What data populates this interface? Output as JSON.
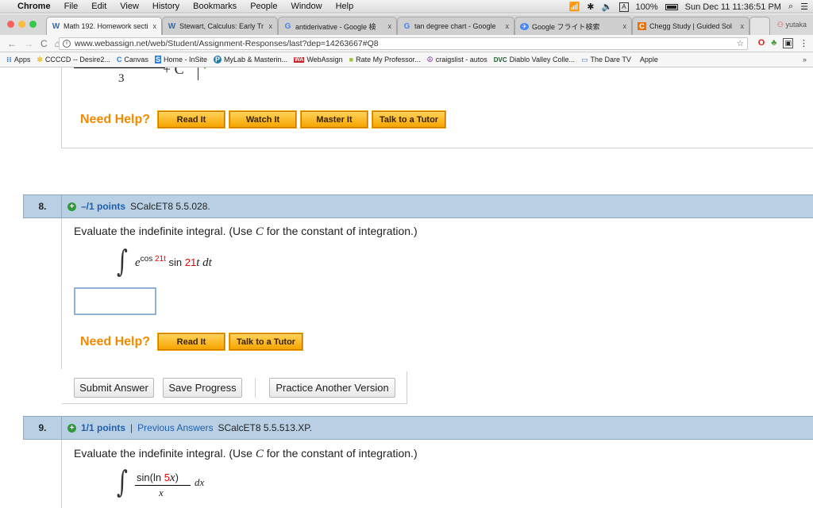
{
  "menubar": {
    "app": "Chrome",
    "items": [
      "File",
      "Edit",
      "View",
      "History",
      "Bookmarks",
      "People",
      "Window",
      "Help"
    ],
    "status": {
      "input_badge": "A",
      "battery": "100%",
      "datetime": "Sun Dec 11  11:36:51 PM"
    }
  },
  "tabs": [
    {
      "icon": "W",
      "label": "Math 192. Homework secti",
      "active": true
    },
    {
      "icon": "W",
      "label": "Stewart, Calculus: Early Tr"
    },
    {
      "icon": "G",
      "label": "antiderivative - Google 検"
    },
    {
      "icon": "G",
      "label": "tan degree chart - Google"
    },
    {
      "icon": "G",
      "label": "Google フライト検索"
    },
    {
      "icon": "C",
      "label": "Chegg Study | Guided Sol"
    }
  ],
  "tab_close": "x",
  "profile": "yutaka",
  "address": {
    "url": "www.webassign.net/web/Student/Assignment-Responses/last?dep=14263667#Q8"
  },
  "bookmarks": [
    {
      "icon": "⁝⁝",
      "label": "Apps"
    },
    {
      "icon": "✻",
      "label": "CCCCD -- Desire2..."
    },
    {
      "icon": "C",
      "label": "Canvas"
    },
    {
      "icon": "S",
      "label": "Home - InSite"
    },
    {
      "icon": "P",
      "label": "MyLab & Masterin..."
    },
    {
      "icon": "WA",
      "label": "WebAssign"
    },
    {
      "icon": "■",
      "label": "Rate My Professor..."
    },
    {
      "icon": "☮",
      "label": "craigslist - autos"
    },
    {
      "icon": "DVC",
      "label": "Diablo Valley Colle..."
    },
    {
      "icon": "▭",
      "label": "The Dare TV"
    },
    {
      "icon": "",
      "label": "Apple"
    }
  ],
  "bookmarks_more": "»",
  "prev_question": {
    "denominator": "3",
    "plus_c": "+ C",
    "help_label": "Need Help?",
    "help_buttons": [
      "Read It",
      "Watch It",
      "Master It",
      "Talk to a Tutor"
    ]
  },
  "q8": {
    "number": "8.",
    "points": "–/1 points",
    "code": "SCalcET8 5.5.028.",
    "prompt_a": "Evaluate the indefinite integral. (Use ",
    "prompt_c": "C",
    "prompt_b": " for the constant of integration.)",
    "expr_e": "e",
    "expr_cos": "cos ",
    "expr_21t_sup": "21t",
    "expr_sin": " sin ",
    "expr_21": "21",
    "expr_t": "t",
    "expr_dt": " dt",
    "help_label": "Need Help?",
    "help_buttons": [
      "Read It",
      "Talk to a Tutor"
    ],
    "actions": [
      "Submit Answer",
      "Save Progress",
      "Practice Another Version"
    ]
  },
  "q9": {
    "number": "9.",
    "points": "1/1 points",
    "sep": "|",
    "prev_answers": "Previous Answers",
    "code": "SCalcET8 5.5.513.XP.",
    "prompt_a": "Evaluate the indefinite integral. (Use ",
    "prompt_c": "C",
    "prompt_b": " for the constant of integration.)",
    "num_a": "sin(ln ",
    "num_5": "5",
    "num_x": "x",
    "num_b": ")",
    "den": "x",
    "dx": "dx"
  },
  "colors": {
    "help_orange": "#f18a00",
    "header_blue": "#b9d0e4",
    "link_blue": "#1d5fb0",
    "red": "#e00000"
  }
}
